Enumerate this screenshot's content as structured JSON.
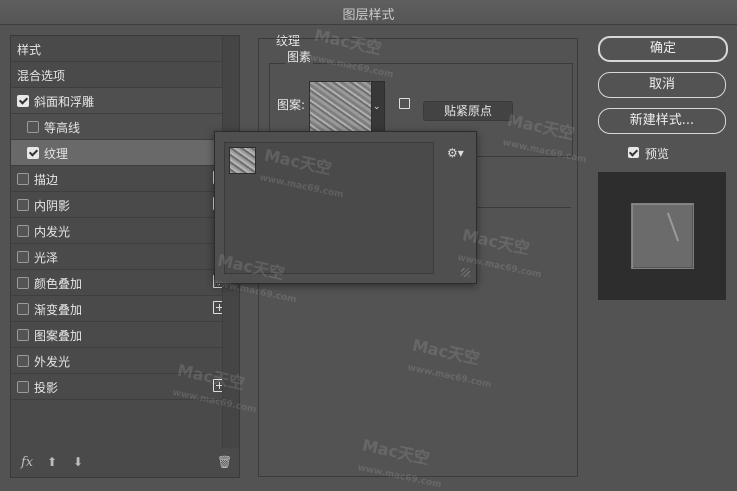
{
  "window": {
    "title": "图层样式"
  },
  "styles_panel": {
    "items": [
      {
        "label": "样式",
        "checkbox": false,
        "checked": false,
        "indent": false,
        "selected": false,
        "plus": false
      },
      {
        "label": "混合选项",
        "checkbox": false,
        "checked": false,
        "indent": false,
        "selected": false,
        "plus": false
      },
      {
        "label": "斜面和浮雕",
        "checkbox": true,
        "checked": true,
        "indent": false,
        "selected": false,
        "plus": false
      },
      {
        "label": "等高线",
        "checkbox": true,
        "checked": false,
        "indent": true,
        "selected": false,
        "plus": false
      },
      {
        "label": "纹理",
        "checkbox": true,
        "checked": true,
        "indent": true,
        "selected": true,
        "plus": false
      },
      {
        "label": "描边",
        "checkbox": true,
        "checked": false,
        "indent": false,
        "selected": false,
        "plus": true
      },
      {
        "label": "内阴影",
        "checkbox": true,
        "checked": false,
        "indent": false,
        "selected": false,
        "plus": true
      },
      {
        "label": "内发光",
        "checkbox": true,
        "checked": false,
        "indent": false,
        "selected": false,
        "plus": false
      },
      {
        "label": "光泽",
        "checkbox": true,
        "checked": false,
        "indent": false,
        "selected": false,
        "plus": false
      },
      {
        "label": "颜色叠加",
        "checkbox": true,
        "checked": false,
        "indent": false,
        "selected": false,
        "plus": true
      },
      {
        "label": "渐变叠加",
        "checkbox": true,
        "checked": false,
        "indent": false,
        "selected": false,
        "plus": true
      },
      {
        "label": "图案叠加",
        "checkbox": true,
        "checked": false,
        "indent": false,
        "selected": false,
        "plus": false
      },
      {
        "label": "外发光",
        "checkbox": true,
        "checked": false,
        "indent": false,
        "selected": false,
        "plus": false
      },
      {
        "label": "投影",
        "checkbox": true,
        "checked": false,
        "indent": false,
        "selected": false,
        "plus": true
      }
    ],
    "footer": {
      "fx_label": "fx",
      "up_icon": "arrow-up-icon",
      "down_icon": "arrow-down-icon",
      "trash_icon": "trash-icon"
    }
  },
  "texture_panel": {
    "section_title": "纹理",
    "group_title": "图素",
    "pattern_label": "图案:",
    "snap_button": "贴紧原点",
    "new_preset_icon": "new-preset-icon"
  },
  "pattern_picker": {
    "gear_icon": "gear-icon"
  },
  "actions": {
    "ok": "确定",
    "cancel": "取消",
    "new_style": "新建样式...",
    "preview_label": "预览",
    "preview_checked": true
  },
  "watermark": {
    "text": "Mac天空",
    "sub": "www.mac69.com"
  }
}
